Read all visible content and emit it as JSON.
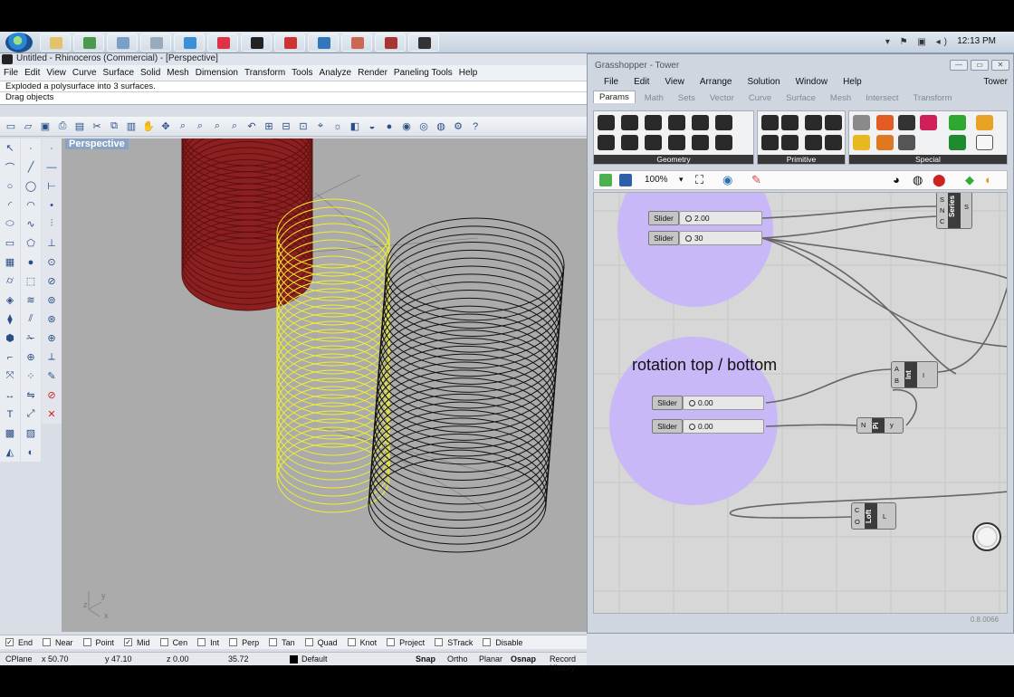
{
  "taskbar": {
    "clock": "12:13 PM",
    "apps": [
      {
        "name": "explorer-app",
        "color": "#e2c36a"
      },
      {
        "name": "rhino-tray-app",
        "color": "#4b9a4b"
      },
      {
        "name": "media-app",
        "color": "#7aa0c8"
      },
      {
        "name": "search-app",
        "color": "#9ab"
      },
      {
        "name": "ie-app",
        "color": "#3b8fd6"
      },
      {
        "name": "chrome-app",
        "color": "#d34"
      },
      {
        "name": "mail-app",
        "color": "#222"
      },
      {
        "name": "pdf-app",
        "color": "#c33"
      },
      {
        "name": "network-app",
        "color": "#37b"
      },
      {
        "name": "powerpoint-app",
        "color": "#c65"
      },
      {
        "name": "rhino-app",
        "color": "#a33"
      },
      {
        "name": "grasshopper-app",
        "color": "#333"
      }
    ]
  },
  "rhino": {
    "title": "Untitled - Rhinoceros (Commercial) - [Perspective]",
    "menu": [
      "File",
      "Edit",
      "View",
      "Curve",
      "Surface",
      "Solid",
      "Mesh",
      "Dimension",
      "Transform",
      "Tools",
      "Analyze",
      "Render",
      "Paneling Tools",
      "Help"
    ],
    "command_history": "Exploded a polysurface into 3 surfaces.",
    "command_prompt": "Drag objects",
    "viewport_label": "Perspective",
    "osnaps": [
      {
        "label": "End",
        "checked": true
      },
      {
        "label": "Near",
        "checked": false
      },
      {
        "label": "Point",
        "checked": false
      },
      {
        "label": "Mid",
        "checked": true
      },
      {
        "label": "Cen",
        "checked": false
      },
      {
        "label": "Int",
        "checked": false
      },
      {
        "label": "Perp",
        "checked": false
      },
      {
        "label": "Tan",
        "checked": false
      },
      {
        "label": "Quad",
        "checked": false
      },
      {
        "label": "Knot",
        "checked": false
      },
      {
        "label": "Project",
        "checked": false
      },
      {
        "label": "STrack",
        "checked": false
      },
      {
        "label": "Disable",
        "checked": false
      }
    ],
    "status": {
      "cplane": "CPlane",
      "x": "x 50.70",
      "y": "y 47.10",
      "z": "z 0.00",
      "dist": "35.72",
      "layer": "Default",
      "snap": "Snap",
      "ortho": "Ortho",
      "planar": "Planar",
      "osnap": "Osnap",
      "record": "Record History"
    },
    "axis_y": "y",
    "axis_x": "x",
    "axis_z": "z",
    "colors": {
      "red_cylinder": "#8c1f1f",
      "yellow_cylinder": "#f2f02a",
      "black_cylinder": "#111111"
    }
  },
  "gh": {
    "title": "Grasshopper - Tower",
    "menu": [
      "File",
      "Edit",
      "View",
      "Arrange",
      "Solution",
      "Window",
      "Help"
    ],
    "doc_name": "Tower",
    "tabs": [
      "Params",
      "Math",
      "Sets",
      "Vector",
      "Curve",
      "Surface",
      "Mesh",
      "Intersect",
      "Transform"
    ],
    "groups": [
      "Geometry",
      "Primitive",
      "Special"
    ],
    "zoom": "100%",
    "version": "0.8.0066",
    "group_title": "rotation top / bottom",
    "sliders": [
      {
        "label": "Slider",
        "value": "2.00"
      },
      {
        "label": "Slider",
        "value": "30"
      },
      {
        "label": "Slider",
        "value": "0.00"
      },
      {
        "label": "Slider",
        "value": "0.00"
      }
    ],
    "components": {
      "series": {
        "name": "Series",
        "inputs": [
          "S",
          "N",
          "C"
        ],
        "output": "S"
      },
      "int": {
        "name": "Int",
        "inputs": [
          "A",
          "B"
        ],
        "output": "I"
      },
      "pi": {
        "name": "Pi",
        "inputs": [
          "N"
        ],
        "output": "y"
      },
      "loft": {
        "name": "Loft",
        "inputs": [
          "C",
          "O"
        ],
        "output": "L"
      }
    },
    "colors": {
      "group_fill": "#c9b8f7",
      "canvas": "#d6d7d6"
    }
  }
}
